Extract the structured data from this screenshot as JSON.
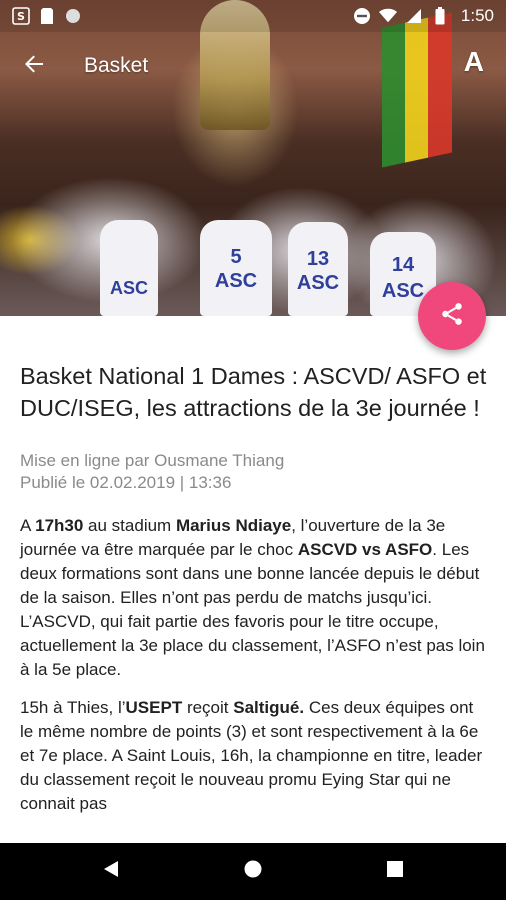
{
  "status_bar": {
    "time": "1:50"
  },
  "app_bar": {
    "title": "Basket",
    "font_button": "A"
  },
  "hero": {
    "jerseys": [
      {
        "number": "",
        "team": "ASC"
      },
      {
        "number": "5",
        "team": "ASC"
      },
      {
        "number": "13",
        "team": "ASC"
      },
      {
        "number": "14",
        "team": "ASC"
      }
    ]
  },
  "article": {
    "title": "Basket National 1 Dames : ASCVD/ ASFO et DUC/ISEG, les attractions de la 3e journée !",
    "author_line": "Mise en ligne par Ousmane Thiang",
    "date_line": "Publié le 02.02.2019 | 13:36",
    "p1": {
      "t1": "A ",
      "b1": "17h30",
      "t2": " au stadium ",
      "b2": "Marius Ndiaye",
      "t3": ", l’ouverture de la 3e journée va être marquée par le choc ",
      "b3": "ASCVD vs ASFO",
      "t4": ". Les deux formations sont dans une bonne lancée depuis le début de la saison. Elles n’ont pas perdu de matchs jusqu’ici. L’ASCVD, qui fait partie des favoris pour le titre occupe, actuellement la 3e place du classement, l’ASFO n’est pas loin à la 5e place."
    },
    "p2": {
      "t1": "15h à Thies, l’",
      "b1": "USEPT",
      "t2": " reçoit ",
      "b2": "Saltigué.",
      "t3": " Ces deux équipes ont le même nombre de points (3) et sont respectivement à la 6e et 7e place. A Saint Louis, 16h, la championne en titre, leader du classement reçoit le nouveau promu Eying Star qui ne connait pas"
    }
  },
  "icons": {
    "back": "arrow-back-icon",
    "share": "share-icon",
    "nav_back": "nav-back-icon",
    "nav_home": "nav-home-icon",
    "nav_recents": "nav-recents-icon"
  },
  "colors": {
    "fab": "#f0487c",
    "nav_bar": "#000000",
    "meta_text": "#8a8a8a"
  }
}
